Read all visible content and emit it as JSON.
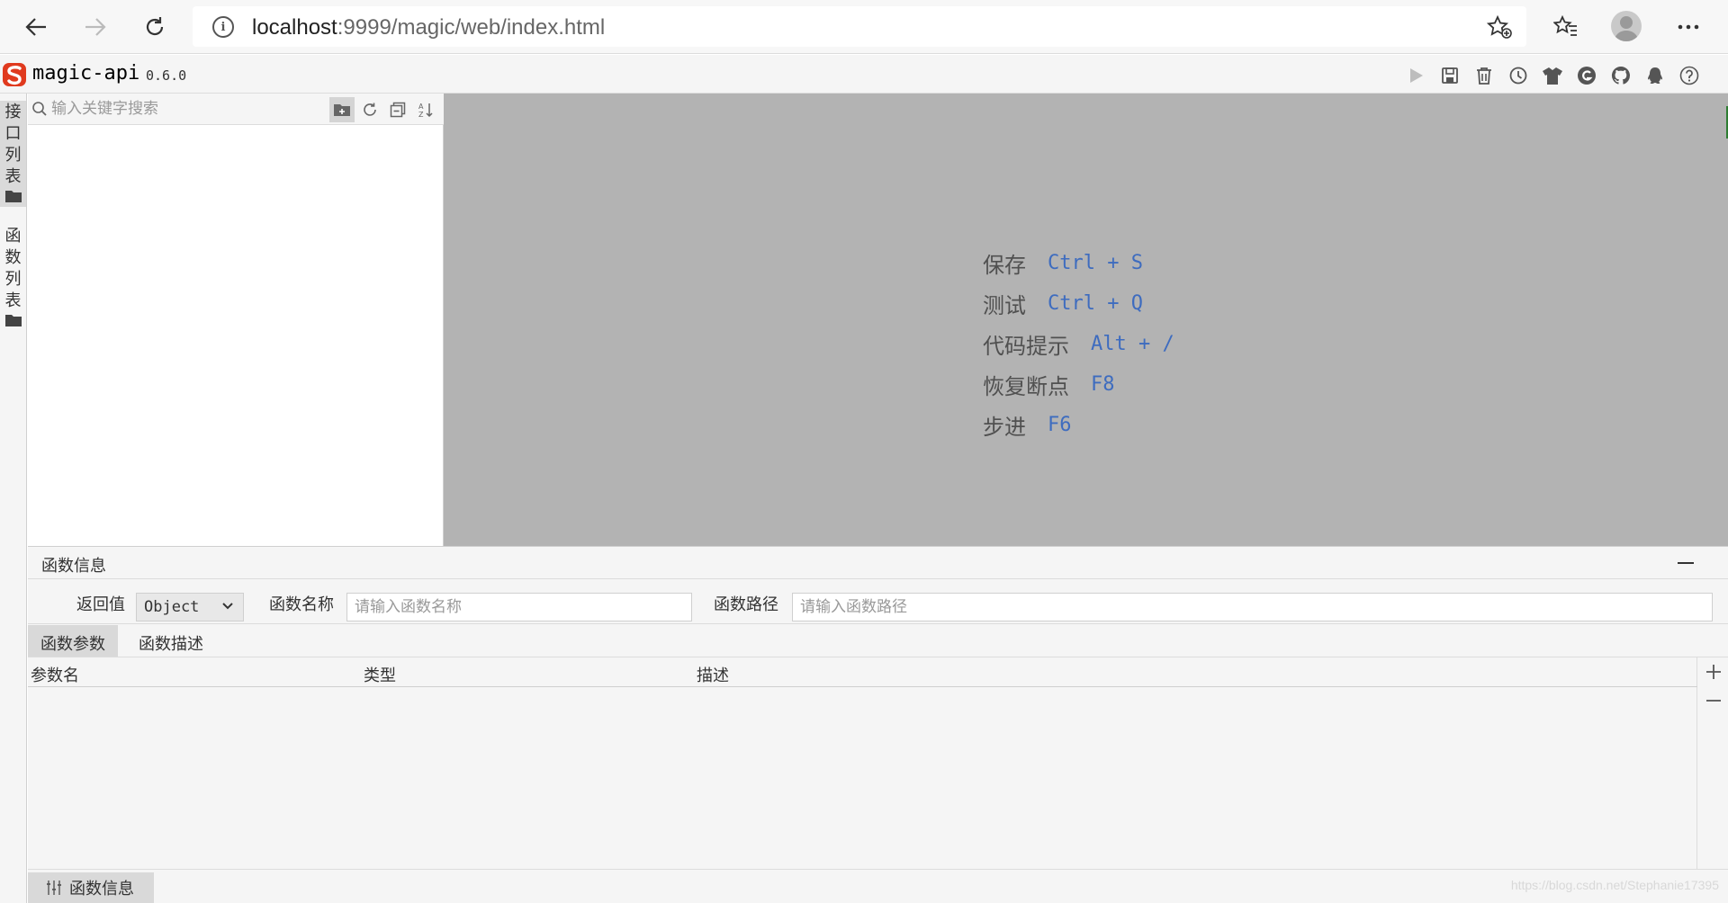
{
  "browser": {
    "url_host": "localhost",
    "url_rest": ":9999/magic/web/index.html",
    "info_glyph": "i"
  },
  "app": {
    "title": "magic-api",
    "version": "0.6.0",
    "header_icons": [
      "run-icon",
      "save-icon",
      "delete-icon",
      "history-icon",
      "skin-icon",
      "g-icon",
      "github-icon",
      "qq-icon",
      "help-icon"
    ]
  },
  "vtabs": [
    {
      "label_chars": [
        "接",
        "口",
        "列",
        "表"
      ],
      "icon": "folder-icon"
    },
    {
      "label_chars": [
        "函",
        "数",
        "列",
        "表"
      ],
      "icon": "folder-icon"
    }
  ],
  "tree": {
    "search_placeholder": "输入关键字搜索"
  },
  "shortcuts": [
    {
      "label": "保存",
      "key": "Ctrl + S"
    },
    {
      "label": "测试",
      "key": "Ctrl + Q"
    },
    {
      "label": "代码提示",
      "key": "Alt + /"
    },
    {
      "label": "恢复断点",
      "key": "F8"
    },
    {
      "label": "步进",
      "key": "F6"
    }
  ],
  "function_info": {
    "title": "函数信息",
    "return_label": "返回值",
    "return_value": "Object",
    "name_label": "函数名称",
    "name_placeholder": "请输入函数名称",
    "path_label": "函数路径",
    "path_placeholder": "请输入函数路径",
    "tabs": [
      "函数参数",
      "函数描述"
    ],
    "columns": [
      "参数名",
      "类型",
      "描述"
    ],
    "add_glyph": "+",
    "bottom_tab": "函数信息"
  },
  "watermark": "https://blog.csdn.net/Stephanie17395"
}
